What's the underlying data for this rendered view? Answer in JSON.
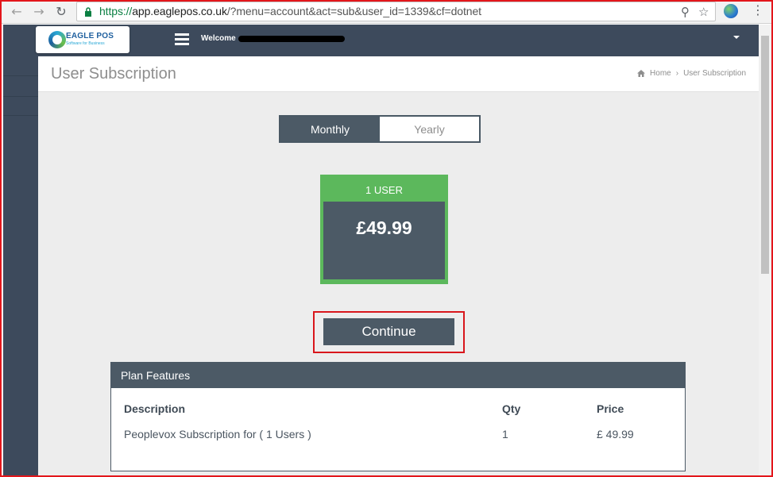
{
  "browser": {
    "url_scheme": "https://",
    "url_host": "app.eaglepos.co.uk",
    "url_path": "/?menu=account&act=sub&user_id=1339&cf=dotnet"
  },
  "app": {
    "logo_name": "EAGLE POS",
    "logo_tagline": "Software for Business",
    "welcome_text": "Welcome"
  },
  "page": {
    "title": "User Subscription",
    "breadcrumb": {
      "home": "Home",
      "current": "User Subscription"
    }
  },
  "billing_toggle": {
    "options": [
      {
        "label": "Monthly",
        "selected": true
      },
      {
        "label": "Yearly",
        "selected": false
      }
    ]
  },
  "plan": {
    "name": "1 USER",
    "price": "£49.99"
  },
  "actions": {
    "continue_label": "Continue"
  },
  "features": {
    "title": "Plan Features",
    "columns": [
      "Description",
      "Qty",
      "Price"
    ],
    "rows": [
      [
        "Peoplevox Subscription for ( 1 Users )",
        "1",
        "£ 49.99"
      ]
    ]
  },
  "colors": {
    "sidebar": "#3d4a5c",
    "slate": "#4c5a66",
    "plan_green": "#5cb85c",
    "highlight_red": "#d9161c"
  }
}
